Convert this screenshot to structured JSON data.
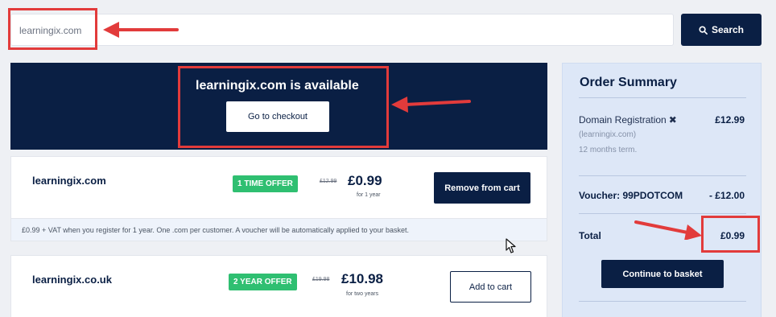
{
  "search": {
    "value": "learningix.com",
    "button_label": "Search"
  },
  "hero": {
    "title": "learningix.com is available",
    "checkout_label": "Go to checkout"
  },
  "results": [
    {
      "domain": "learningix.com",
      "badge": "1 TIME OFFER",
      "old_price": "£12.99",
      "price": "£0.99",
      "term": "for 1 year",
      "action": "Remove from cart",
      "note": "£0.99 + VAT when you register for 1 year. One .com per customer. A voucher will be automatically applied to your basket."
    },
    {
      "domain": "learningix.co.uk",
      "badge": "2 YEAR OFFER",
      "old_price": "£19.98",
      "price": "£10.98",
      "term": "for two years",
      "action": "Add to cart"
    }
  ],
  "summary": {
    "title": "Order Summary",
    "item_label": "Domain Registration",
    "item_remove_icon": "close-icon",
    "item_price": "£12.99",
    "item_domain": "(learningix.com)",
    "item_term": "12 months term.",
    "voucher_label": "Voucher: 99PDOTCOM",
    "voucher_value": "- £12.00",
    "total_label": "Total",
    "total_value": "£0.99",
    "continue_label": "Continue to basket"
  },
  "colors": {
    "navy": "#0a1f44",
    "offer_green": "#2fbf71",
    "annotation_red": "#e23b3b",
    "summary_bg": "#dde7f7"
  }
}
